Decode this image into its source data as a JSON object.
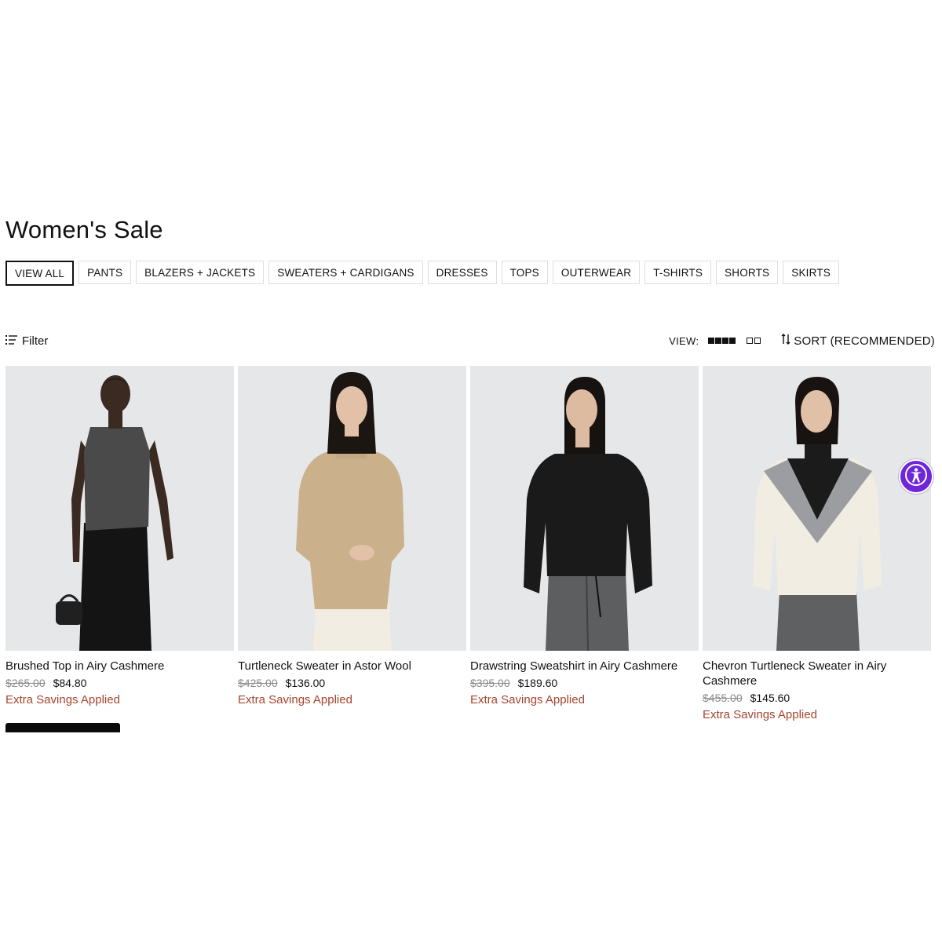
{
  "page": {
    "title": "Women's Sale"
  },
  "categories": [
    {
      "label": "VIEW ALL",
      "active": true
    },
    {
      "label": "PANTS"
    },
    {
      "label": "BLAZERS + JACKETS"
    },
    {
      "label": "SWEATERS + CARDIGANS"
    },
    {
      "label": "DRESSES"
    },
    {
      "label": "TOPS"
    },
    {
      "label": "OUTERWEAR"
    },
    {
      "label": "T-SHIRTS"
    },
    {
      "label": "SHORTS"
    },
    {
      "label": "SKIRTS"
    }
  ],
  "toolbar": {
    "filter_label": "Filter",
    "filter_icon": "filter-lines-icon",
    "view_label": "VIEW:",
    "sort_label": "SORT (RECOMMENDED)",
    "sort_icon": "sort-arrows-icon"
  },
  "products": [
    {
      "name": "Brushed Top in Airy Cashmere",
      "old_price": "$265.00",
      "new_price": "$84.80",
      "savings": "Extra Savings Applied",
      "garment_color": "#4a4a4a"
    },
    {
      "name": "Turtleneck Sweater in Astor Wool",
      "old_price": "$425.00",
      "new_price": "$136.00",
      "savings": "Extra Savings Applied",
      "garment_color": "#cbb08c"
    },
    {
      "name": "Drawstring Sweatshirt in Airy Cashmere",
      "old_price": "$395.00",
      "new_price": "$189.60",
      "savings": "Extra Savings Applied",
      "garment_color": "#1a1a1a"
    },
    {
      "name": "Chevron Turtleneck Sweater in Airy Cashmere",
      "old_price": "$455.00",
      "new_price": "$145.60",
      "savings": "Extra Savings Applied",
      "garment_color": "#f1ede3"
    }
  ],
  "colors": {
    "accent_savings": "#a5442f",
    "accessibility_button": "#6f25d8",
    "image_background": "#e7e8ea"
  },
  "accessibility": {
    "icon": "accessibility-person-icon"
  }
}
